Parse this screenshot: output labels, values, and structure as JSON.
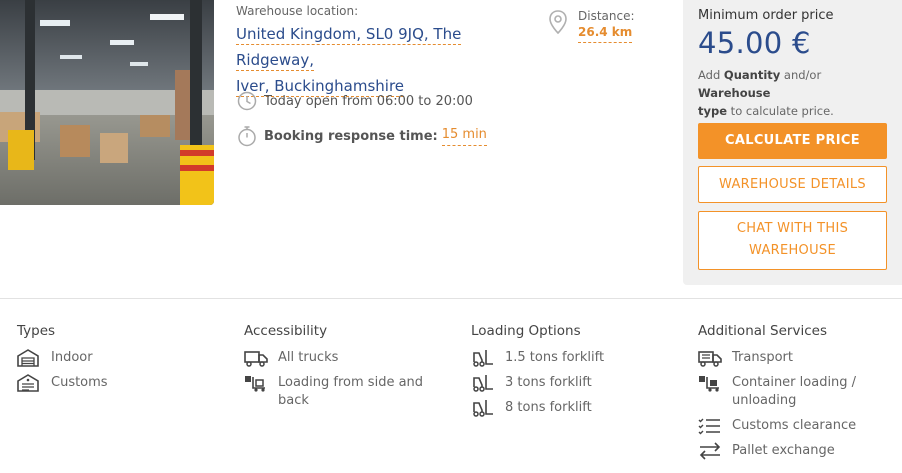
{
  "location": {
    "label": "Warehouse location:",
    "line1": "United Kingdom, SL0 9JQ, The Ridgeway,",
    "line2": "Iver, Buckinghamshire"
  },
  "distance": {
    "label": "Distance:",
    "value": "26.4 km",
    "icon": "map-pin-icon"
  },
  "hours": {
    "text": "Today open from 06:00 to 20:00",
    "icon": "clock-icon"
  },
  "booking": {
    "label": "Booking response time:",
    "value": "15 min",
    "icon": "stopwatch-icon"
  },
  "price_panel": {
    "label": "Minimum order price",
    "price": "45.00 €",
    "note_pre": "Add ",
    "note_quantity": "Quantity",
    "note_mid": " and/or ",
    "note_warehouse": "Warehouse",
    "note_type": "type",
    "note_post": " to calculate price.",
    "calculate_label": "CALCULATE PRICE",
    "details_label": "WAREHOUSE DETAILS",
    "chat_label": "CHAT WITH THIS WAREHOUSE"
  },
  "columns": {
    "types": {
      "title": "Types",
      "items": [
        {
          "label": "Indoor",
          "icon": "warehouse-icon"
        },
        {
          "label": "Customs",
          "icon": "customs-warehouse-icon"
        }
      ]
    },
    "accessibility": {
      "title": "Accessibility",
      "items": [
        {
          "label": "All trucks",
          "icon": "truck-icon"
        },
        {
          "label": "Loading from side and back",
          "icon": "loading-icon"
        }
      ]
    },
    "loading": {
      "title": "Loading Options",
      "items": [
        {
          "label": "1.5 tons forklift",
          "icon": "forklift-icon"
        },
        {
          "label": "3 tons forklift",
          "icon": "forklift-icon"
        },
        {
          "label": "8 tons forklift",
          "icon": "forklift-icon"
        }
      ]
    },
    "services": {
      "title": "Additional Services",
      "items": [
        {
          "label": "Transport",
          "icon": "truck-icon"
        },
        {
          "label": "Container loading / unloading",
          "icon": "container-loading-icon"
        },
        {
          "label": "Customs clearance",
          "icon": "checklist-icon"
        },
        {
          "label": "Pallet exchange",
          "icon": "swap-arrows-icon"
        }
      ]
    }
  },
  "colors": {
    "accent": "#f39228",
    "brand": "#2b4c8c",
    "panel_bg": "#f0f0f0"
  }
}
